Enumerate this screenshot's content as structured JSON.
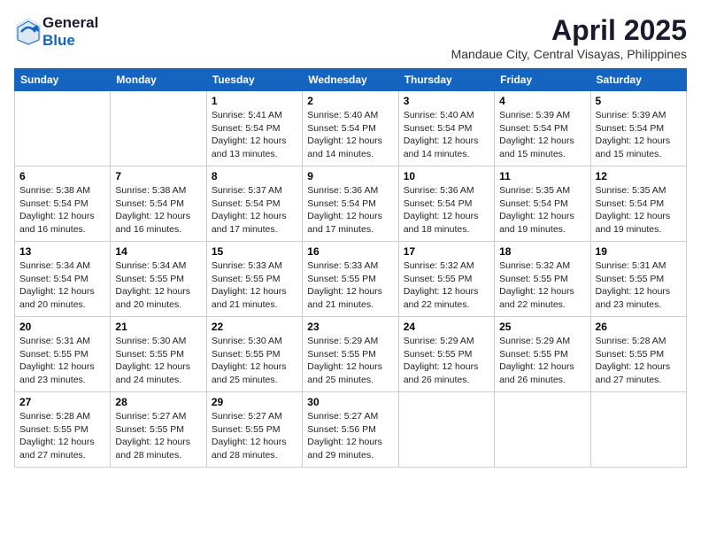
{
  "header": {
    "logo_general": "General",
    "logo_blue": "Blue",
    "month_title": "April 2025",
    "subtitle": "Mandaue City, Central Visayas, Philippines"
  },
  "days_of_week": [
    "Sunday",
    "Monday",
    "Tuesday",
    "Wednesday",
    "Thursday",
    "Friday",
    "Saturday"
  ],
  "weeks": [
    [
      {
        "day": "",
        "sunrise": "",
        "sunset": "",
        "daylight": ""
      },
      {
        "day": "",
        "sunrise": "",
        "sunset": "",
        "daylight": ""
      },
      {
        "day": "1",
        "sunrise": "Sunrise: 5:41 AM",
        "sunset": "Sunset: 5:54 PM",
        "daylight": "Daylight: 12 hours and 13 minutes."
      },
      {
        "day": "2",
        "sunrise": "Sunrise: 5:40 AM",
        "sunset": "Sunset: 5:54 PM",
        "daylight": "Daylight: 12 hours and 14 minutes."
      },
      {
        "day": "3",
        "sunrise": "Sunrise: 5:40 AM",
        "sunset": "Sunset: 5:54 PM",
        "daylight": "Daylight: 12 hours and 14 minutes."
      },
      {
        "day": "4",
        "sunrise": "Sunrise: 5:39 AM",
        "sunset": "Sunset: 5:54 PM",
        "daylight": "Daylight: 12 hours and 15 minutes."
      },
      {
        "day": "5",
        "sunrise": "Sunrise: 5:39 AM",
        "sunset": "Sunset: 5:54 PM",
        "daylight": "Daylight: 12 hours and 15 minutes."
      }
    ],
    [
      {
        "day": "6",
        "sunrise": "Sunrise: 5:38 AM",
        "sunset": "Sunset: 5:54 PM",
        "daylight": "Daylight: 12 hours and 16 minutes."
      },
      {
        "day": "7",
        "sunrise": "Sunrise: 5:38 AM",
        "sunset": "Sunset: 5:54 PM",
        "daylight": "Daylight: 12 hours and 16 minutes."
      },
      {
        "day": "8",
        "sunrise": "Sunrise: 5:37 AM",
        "sunset": "Sunset: 5:54 PM",
        "daylight": "Daylight: 12 hours and 17 minutes."
      },
      {
        "day": "9",
        "sunrise": "Sunrise: 5:36 AM",
        "sunset": "Sunset: 5:54 PM",
        "daylight": "Daylight: 12 hours and 17 minutes."
      },
      {
        "day": "10",
        "sunrise": "Sunrise: 5:36 AM",
        "sunset": "Sunset: 5:54 PM",
        "daylight": "Daylight: 12 hours and 18 minutes."
      },
      {
        "day": "11",
        "sunrise": "Sunrise: 5:35 AM",
        "sunset": "Sunset: 5:54 PM",
        "daylight": "Daylight: 12 hours and 19 minutes."
      },
      {
        "day": "12",
        "sunrise": "Sunrise: 5:35 AM",
        "sunset": "Sunset: 5:54 PM",
        "daylight": "Daylight: 12 hours and 19 minutes."
      }
    ],
    [
      {
        "day": "13",
        "sunrise": "Sunrise: 5:34 AM",
        "sunset": "Sunset: 5:54 PM",
        "daylight": "Daylight: 12 hours and 20 minutes."
      },
      {
        "day": "14",
        "sunrise": "Sunrise: 5:34 AM",
        "sunset": "Sunset: 5:55 PM",
        "daylight": "Daylight: 12 hours and 20 minutes."
      },
      {
        "day": "15",
        "sunrise": "Sunrise: 5:33 AM",
        "sunset": "Sunset: 5:55 PM",
        "daylight": "Daylight: 12 hours and 21 minutes."
      },
      {
        "day": "16",
        "sunrise": "Sunrise: 5:33 AM",
        "sunset": "Sunset: 5:55 PM",
        "daylight": "Daylight: 12 hours and 21 minutes."
      },
      {
        "day": "17",
        "sunrise": "Sunrise: 5:32 AM",
        "sunset": "Sunset: 5:55 PM",
        "daylight": "Daylight: 12 hours and 22 minutes."
      },
      {
        "day": "18",
        "sunrise": "Sunrise: 5:32 AM",
        "sunset": "Sunset: 5:55 PM",
        "daylight": "Daylight: 12 hours and 22 minutes."
      },
      {
        "day": "19",
        "sunrise": "Sunrise: 5:31 AM",
        "sunset": "Sunset: 5:55 PM",
        "daylight": "Daylight: 12 hours and 23 minutes."
      }
    ],
    [
      {
        "day": "20",
        "sunrise": "Sunrise: 5:31 AM",
        "sunset": "Sunset: 5:55 PM",
        "daylight": "Daylight: 12 hours and 23 minutes."
      },
      {
        "day": "21",
        "sunrise": "Sunrise: 5:30 AM",
        "sunset": "Sunset: 5:55 PM",
        "daylight": "Daylight: 12 hours and 24 minutes."
      },
      {
        "day": "22",
        "sunrise": "Sunrise: 5:30 AM",
        "sunset": "Sunset: 5:55 PM",
        "daylight": "Daylight: 12 hours and 25 minutes."
      },
      {
        "day": "23",
        "sunrise": "Sunrise: 5:29 AM",
        "sunset": "Sunset: 5:55 PM",
        "daylight": "Daylight: 12 hours and 25 minutes."
      },
      {
        "day": "24",
        "sunrise": "Sunrise: 5:29 AM",
        "sunset": "Sunset: 5:55 PM",
        "daylight": "Daylight: 12 hours and 26 minutes."
      },
      {
        "day": "25",
        "sunrise": "Sunrise: 5:29 AM",
        "sunset": "Sunset: 5:55 PM",
        "daylight": "Daylight: 12 hours and 26 minutes."
      },
      {
        "day": "26",
        "sunrise": "Sunrise: 5:28 AM",
        "sunset": "Sunset: 5:55 PM",
        "daylight": "Daylight: 12 hours and 27 minutes."
      }
    ],
    [
      {
        "day": "27",
        "sunrise": "Sunrise: 5:28 AM",
        "sunset": "Sunset: 5:55 PM",
        "daylight": "Daylight: 12 hours and 27 minutes."
      },
      {
        "day": "28",
        "sunrise": "Sunrise: 5:27 AM",
        "sunset": "Sunset: 5:55 PM",
        "daylight": "Daylight: 12 hours and 28 minutes."
      },
      {
        "day": "29",
        "sunrise": "Sunrise: 5:27 AM",
        "sunset": "Sunset: 5:55 PM",
        "daylight": "Daylight: 12 hours and 28 minutes."
      },
      {
        "day": "30",
        "sunrise": "Sunrise: 5:27 AM",
        "sunset": "Sunset: 5:56 PM",
        "daylight": "Daylight: 12 hours and 29 minutes."
      },
      {
        "day": "",
        "sunrise": "",
        "sunset": "",
        "daylight": ""
      },
      {
        "day": "",
        "sunrise": "",
        "sunset": "",
        "daylight": ""
      },
      {
        "day": "",
        "sunrise": "",
        "sunset": "",
        "daylight": ""
      }
    ]
  ]
}
